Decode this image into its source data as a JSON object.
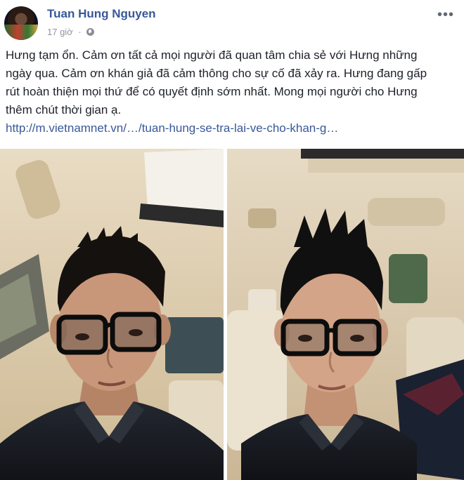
{
  "post": {
    "author": "Tuan Hung Nguyen",
    "time": "17 giờ",
    "separator": "·",
    "more_icon": "more-horizontal-icon",
    "privacy_icon": "globe-icon",
    "text": "Hưng tạm ổn. Cảm ơn tất cả mọi người đã quan tâm chia sẻ với Hưng những ngày qua. Cảm ơn khán giả đã cảm thông cho sự cố đã xảy ra. Hưng đang gấp rút hoàn thiện mọi thứ để có quyết định sớm nhất. Mong mọi người cho Hưng thêm chút thời gian ạ.",
    "link": "http://m.vietnamnet.vn/…/tuan-hung-se-tra-lai-ve-cho-khan-g…"
  },
  "colors": {
    "link": "#385898",
    "text": "#1d2129",
    "meta": "#90949c"
  }
}
